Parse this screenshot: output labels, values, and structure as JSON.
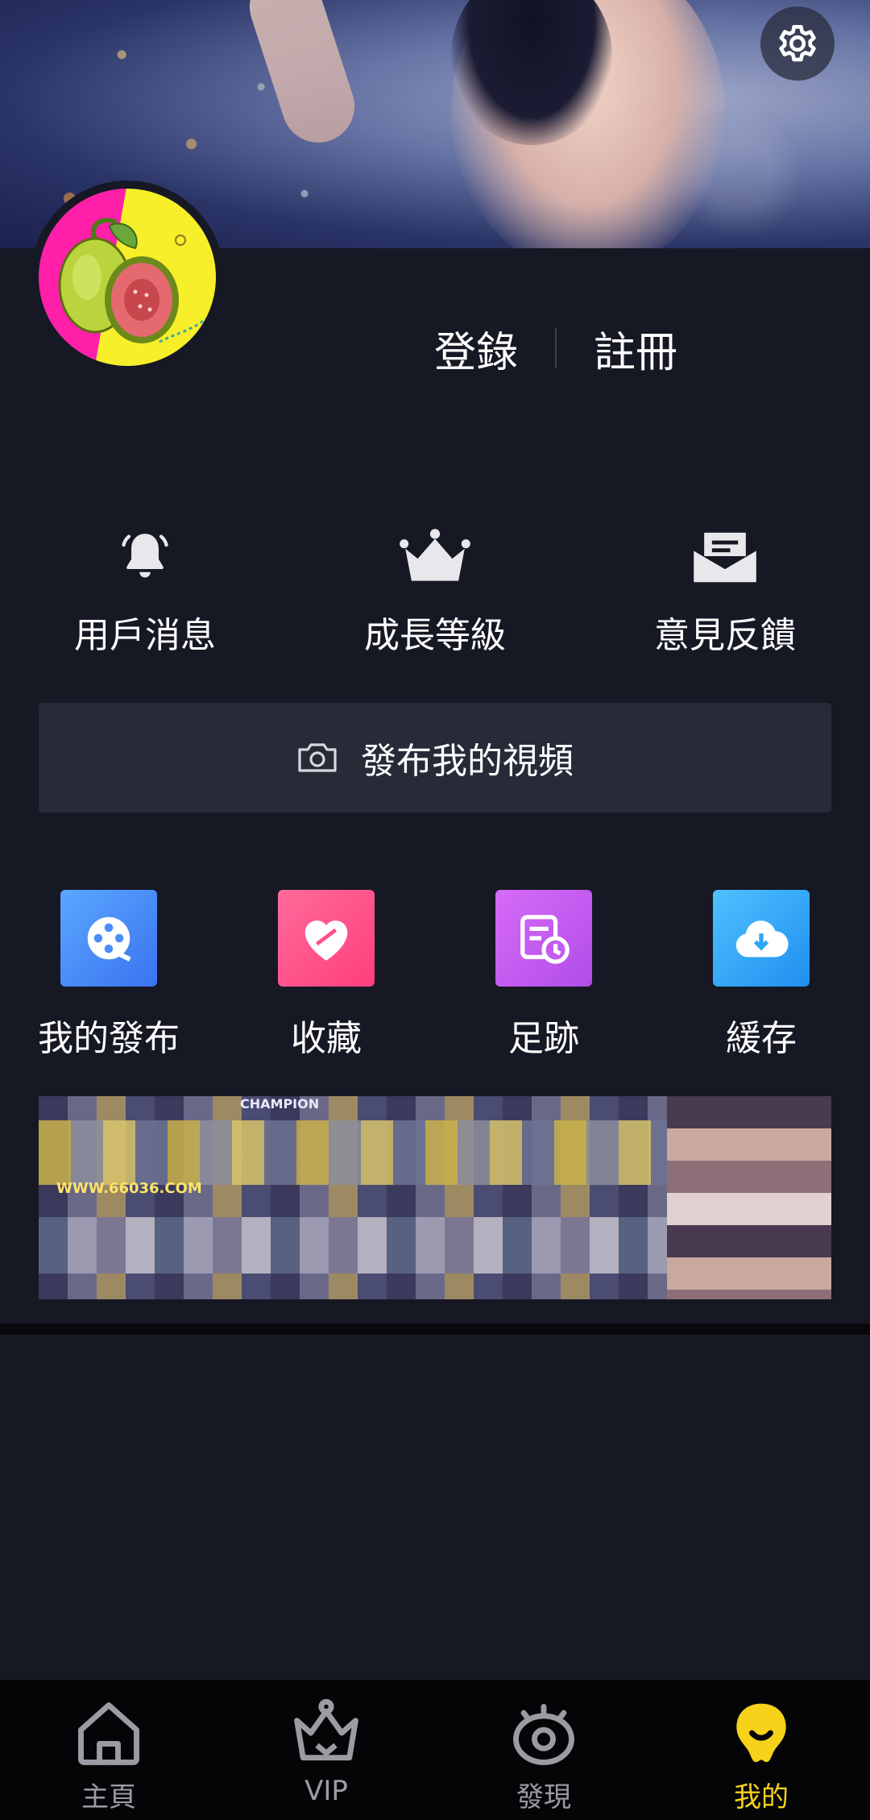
{
  "header": {
    "settings_icon": "gear-icon",
    "avatar_icon": "guava-logo"
  },
  "auth": {
    "login_label": "登錄",
    "register_label": "註冊"
  },
  "quick_actions": [
    {
      "label": "用戶消息",
      "icon": "bell-icon"
    },
    {
      "label": "成長等級",
      "icon": "crown-icon"
    },
    {
      "label": "意見反饋",
      "icon": "mail-icon"
    }
  ],
  "publish": {
    "label": "發布我的視頻",
    "icon": "camera-icon"
  },
  "features": [
    {
      "label": "我的發布",
      "icon": "film-reel-icon",
      "color": "#4a8dfa"
    },
    {
      "label": "收藏",
      "icon": "heart-icon",
      "color": "#ff4f8b"
    },
    {
      "label": "足跡",
      "icon": "history-icon",
      "color": "#c45cf2"
    },
    {
      "label": "緩存",
      "icon": "cloud-download-icon",
      "color": "#2ea7f4"
    }
  ],
  "ad": {
    "url_text": "WWW.66036.COM",
    "top_text": "CHAMPION"
  },
  "tabbar": {
    "items": [
      {
        "label": "主頁",
        "icon": "home-icon",
        "active": false
      },
      {
        "label": "VIP",
        "icon": "crown-icon",
        "active": false
      },
      {
        "label": "發現",
        "icon": "eye-icon",
        "active": false
      },
      {
        "label": "我的",
        "icon": "guava-icon",
        "active": true
      }
    ],
    "active_color": "#f6d21a"
  }
}
